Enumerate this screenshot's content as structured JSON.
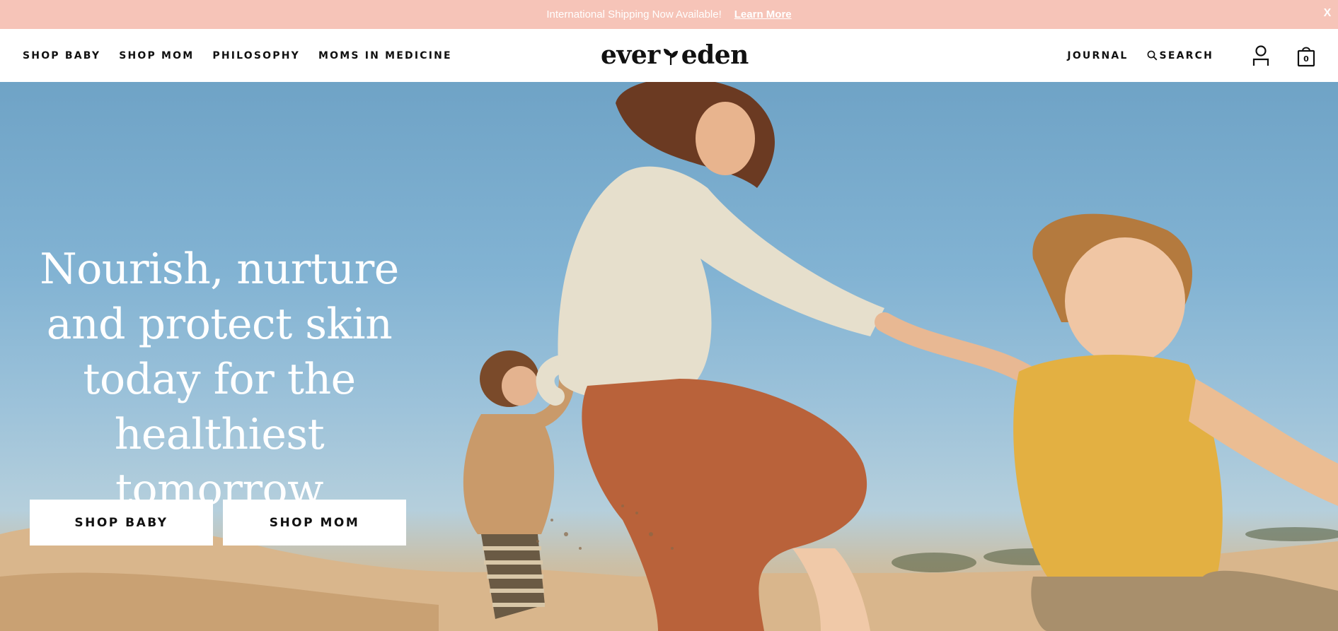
{
  "announcement": {
    "message": "International Shipping Now Available!",
    "link_label": "Learn More",
    "close_label": "X"
  },
  "header": {
    "nav_left": [
      "SHOP BABY",
      "SHOP MOM",
      "PHILOSOPHY",
      "MOMS IN MEDICINE"
    ],
    "logo_left": "ever",
    "logo_right": "eden",
    "nav_right": {
      "journal": "JOURNAL",
      "search": "SEARCH",
      "cart_count": "0"
    },
    "icons": [
      "search-icon",
      "account-icon",
      "shopping-bag-icon"
    ]
  },
  "hero": {
    "headline": "Nourish, nurture and protect skin today for the healthiest tomorrow",
    "cta_primary": "SHOP BABY",
    "cta_secondary": "SHOP MOM"
  },
  "colors": {
    "announcement_bg": "#f6c4b8",
    "text": "#111111",
    "sky": "#82b3d3",
    "sand": "#d9b68c"
  }
}
